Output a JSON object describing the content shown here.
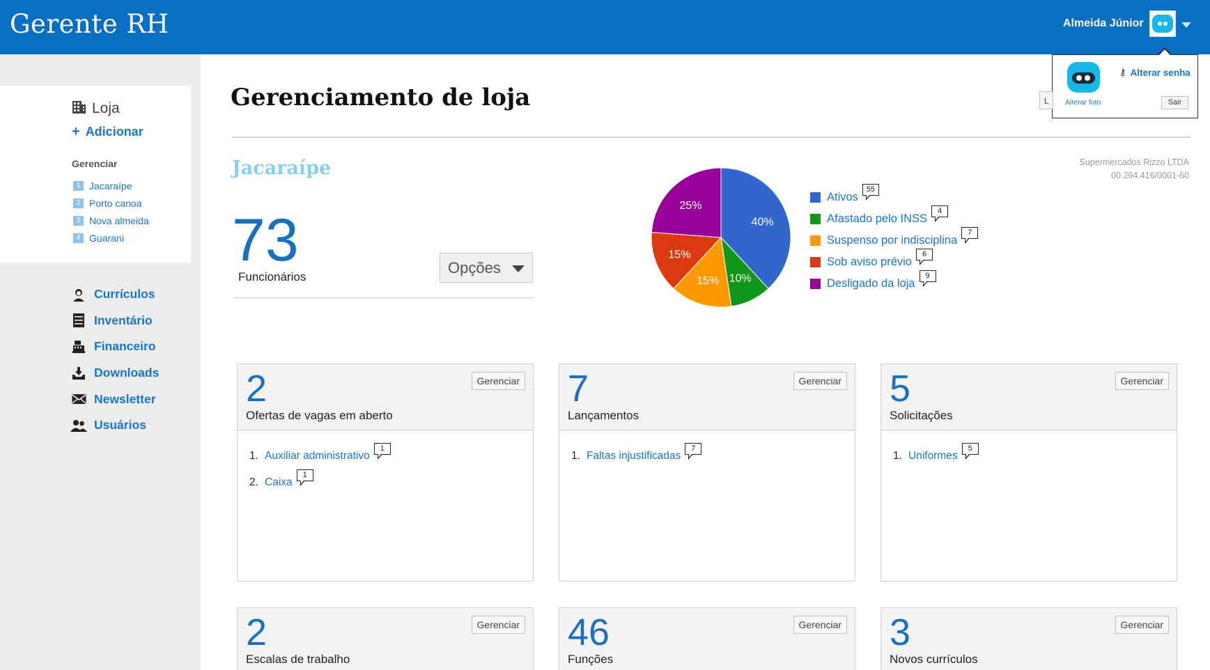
{
  "header": {
    "brand": "Gerente RH",
    "user_name": "Almeida Júnior"
  },
  "user_popup": {
    "change_password": "Alterar senha",
    "change_photo": "Alterar foto",
    "logout": "Sair"
  },
  "sidebar": {
    "section_title": "Loja",
    "add_label": "Adicionar",
    "manage_title": "Gerenciar",
    "stores": [
      {
        "num": "1",
        "label": "Jacaraípe"
      },
      {
        "num": "2",
        "label": "Porto canoa"
      },
      {
        "num": "3",
        "label": "Nova almeida"
      },
      {
        "num": "4",
        "label": "Guarani"
      }
    ],
    "nav": [
      {
        "icon": "resume-person-icon",
        "label": "Currículos"
      },
      {
        "icon": "cabinet-icon",
        "label": "Inventário"
      },
      {
        "icon": "cash-register-icon",
        "label": "Financeiro"
      },
      {
        "icon": "download-tray-icon",
        "label": "Downloads"
      },
      {
        "icon": "envelope-icon",
        "label": "Newsletter"
      },
      {
        "icon": "users-icon",
        "label": "Usuários"
      }
    ]
  },
  "main": {
    "page_title": "Gerenciamento de loja",
    "hidden_button_initial": "L",
    "store_name": "Jacaraípe",
    "company_name": "Supermercados Rizzo LTDA",
    "company_cnpj": "00.294.416/0001-60",
    "employee_count": "73",
    "employee_label": "Funcionários",
    "options_label": "Opções"
  },
  "chart_data": {
    "type": "pie",
    "slices": [
      {
        "label": "Ativos",
        "percent": 40,
        "color": "#3366cc",
        "count": "55"
      },
      {
        "label": "Afastado pelo INSS",
        "percent": 10,
        "color": "#109618",
        "count": "4"
      },
      {
        "label": "Suspenso por indisciplina",
        "percent": 15,
        "color": "#ff9900",
        "count": "7"
      },
      {
        "label": "Sob aviso prévio",
        "percent": 15,
        "color": "#dc3912",
        "count": "6"
      },
      {
        "label": "Desligado da loja",
        "percent": 25,
        "color": "#990099",
        "count": "9"
      }
    ],
    "slice_labels": [
      "40%",
      "15%",
      "15%",
      "10%",
      "25%"
    ],
    "legend_position": "right"
  },
  "panels": [
    {
      "num": "2",
      "label": "Ofertas de vagas em aberto",
      "button": "Gerenciar",
      "items": [
        {
          "idx": "1.",
          "label": "Auxiliar administrativo",
          "count": "1"
        },
        {
          "idx": "2.",
          "label": "Caixa",
          "count": "1"
        }
      ]
    },
    {
      "num": "7",
      "label": "Lançamentos",
      "button": "Gerenciar",
      "items": [
        {
          "idx": "1.",
          "label": "Faltas injustificadas",
          "count": "7"
        }
      ]
    },
    {
      "num": "5",
      "label": "Solicitações",
      "button": "Gerenciar",
      "items": [
        {
          "idx": "1.",
          "label": "Uniformes",
          "count": "5"
        }
      ]
    },
    {
      "num": "2",
      "label": "Escalas de trabalho",
      "button": "Gerenciar",
      "items": []
    },
    {
      "num": "46",
      "label": "Funções",
      "button": "Gerenciar",
      "items": []
    },
    {
      "num": "3",
      "label": "Novos currículos",
      "button": "Gerenciar",
      "items": []
    }
  ]
}
